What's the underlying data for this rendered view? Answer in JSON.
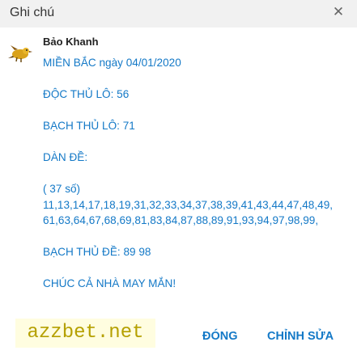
{
  "dialog": {
    "title": "Ghi chú",
    "close_icon": "close-icon"
  },
  "note": {
    "author": "Bảo Khanh",
    "avatar_icon": "bird-icon",
    "lines": [
      "MIỀN BẮC ngày 04/01/2020",
      "",
      "ĐỘC THỦ LÔ: 56",
      "",
      "BẠCH THỦ LÔ: 71",
      "",
      "DÀN ĐỀ:",
      "",
      "( 37 số)",
      "11,13,14,17,18,19,31,32,33,34,37,38,39,41,43,44,47,48,49,",
      "61,63,64,67,68,69,81,83,84,87,88,89,91,93,94,97,98,99,",
      "",
      "BẠCH THỦ ĐỀ:   89 98",
      "",
      "CHÚC CẢ NHÀ MAY MẮN!"
    ]
  },
  "watermark": "azzbet.net",
  "buttons": {
    "close": "ĐÓNG",
    "edit": "CHỈNH SỬA"
  },
  "colors": {
    "accent": "#1479c7",
    "header_bg": "#f1f1f1",
    "watermark_text": "#b5a000",
    "watermark_bg": "#fffde0"
  }
}
